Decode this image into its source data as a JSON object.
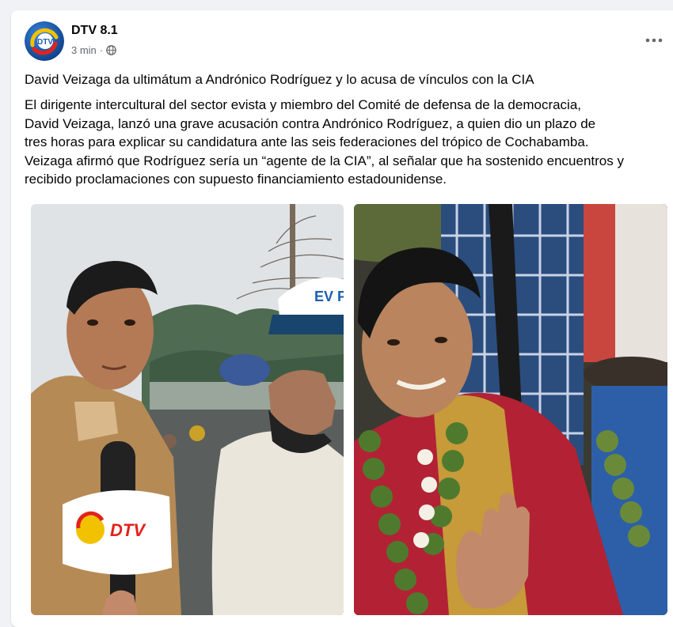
{
  "post": {
    "page_name": "DTV 8.1",
    "time": "3 min",
    "separator": "·",
    "audience_icon": "globe-icon",
    "more_icon": "more-options-icon",
    "headline": "David Veizaga da ultimátum a Andrónico Rodríguez y lo acusa de vínculos con la CIA",
    "body_lines": [
      "El dirigente intercultural del sector evista y miembro del Comité de defensa de la democracia,",
      "David Veizaga, lanzó una grave acusación contra Andrónico Rodríguez, a quien dio un plazo de",
      "tres horas para explicar su candidatura ante las seis federaciones del trópico de Cochabamba.",
      "Veizaga afirmó que Rodríguez sería un “agente de la CIA”, al señalar que ha sostenido encuentros y",
      "recibido proclamaciones con supuesto financiamiento estadounidense."
    ],
    "photos": {
      "left": {
        "mic_logo": "DTV",
        "cap_text": "EV Pu"
      },
      "right": {}
    }
  },
  "colors": {
    "page_bg": "#f0f2f5",
    "card_bg": "#ffffff",
    "text_primary": "#050505",
    "text_secondary": "#65676b",
    "logo_blue": "#1b5fae",
    "logo_red": "#e2231a"
  }
}
